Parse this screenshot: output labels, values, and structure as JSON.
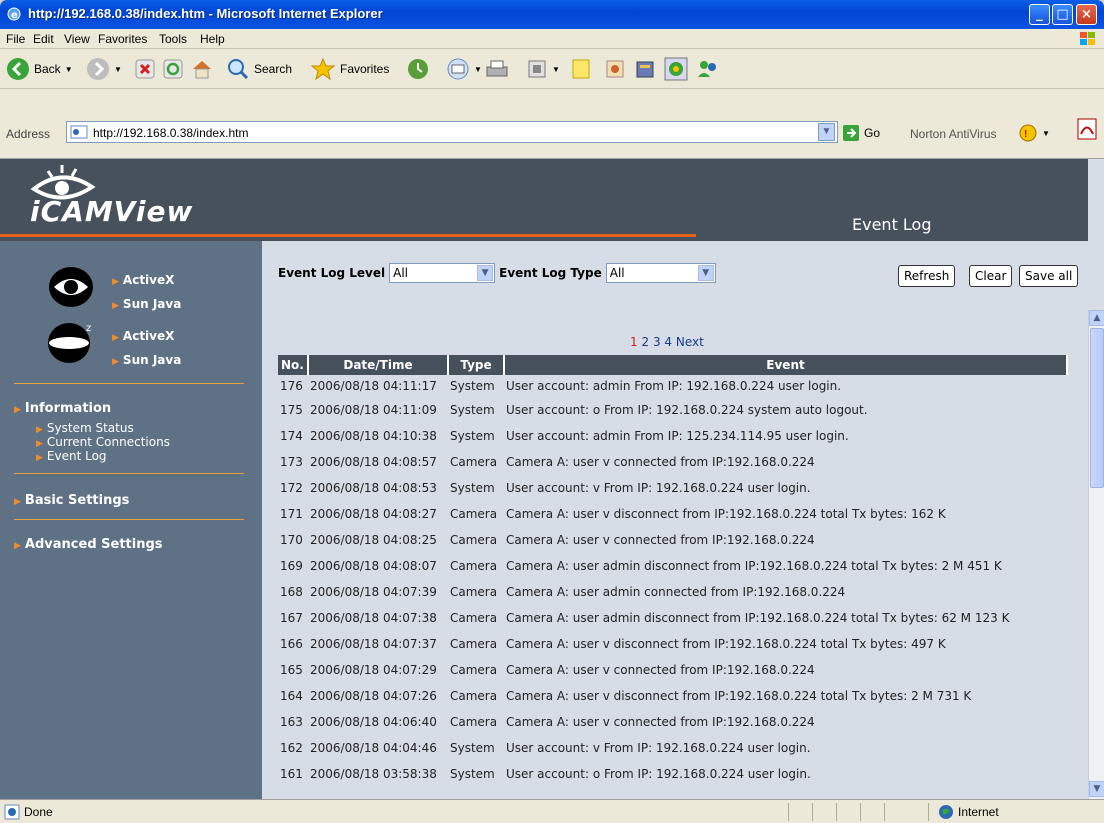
{
  "window": {
    "title": "http://192.168.0.38/index.htm - Microsoft Internet Explorer"
  },
  "menu": [
    "File",
    "Edit",
    "View",
    "Favorites",
    "Tools",
    "Help"
  ],
  "toolbar": {
    "back": "Back",
    "search": "Search",
    "favorites": "Favorites"
  },
  "address": {
    "label": "Address",
    "url": "http://192.168.0.38/index.htm",
    "go": "Go",
    "norton": "Norton AntiVirus"
  },
  "app": {
    "logo": "iCAMView",
    "heading": "Event Log"
  },
  "sidebar": {
    "cam1": {
      "activex": "ActiveX",
      "java": "Sun Java"
    },
    "cam2": {
      "activex": "ActiveX",
      "java": "Sun Java"
    },
    "information": "Information",
    "info_items": [
      "System Status",
      "Current Connections",
      "Event Log"
    ],
    "basic": "Basic Settings",
    "advanced": "Advanced Settings"
  },
  "filters": {
    "level_label": "Event Log Level",
    "level_value": "All",
    "type_label": "Event Log Type",
    "type_value": "All"
  },
  "buttons": {
    "refresh": "Refresh",
    "clear": "Clear",
    "save_all": "Save all"
  },
  "pagination": {
    "pages": [
      "1",
      "2",
      "3",
      "4"
    ],
    "current": "1",
    "next": "Next"
  },
  "table": {
    "headers": [
      "No.",
      "Date/Time",
      "Type",
      "Event"
    ],
    "rows": [
      [
        "176",
        "2006/08/18 04:11:17",
        "System",
        "User account: admin From IP: 192.168.0.224 user login."
      ],
      [
        "175",
        "2006/08/18 04:11:09",
        "System",
        "User account: o From IP: 192.168.0.224 system auto logout."
      ],
      [
        "174",
        "2006/08/18 04:10:38",
        "System",
        "User account: admin From IP: 125.234.114.95 user login."
      ],
      [
        "173",
        "2006/08/18 04:08:57",
        "Camera",
        "Camera A: user v connected from IP:192.168.0.224"
      ],
      [
        "172",
        "2006/08/18 04:08:53",
        "System",
        "User account: v From IP: 192.168.0.224 user login."
      ],
      [
        "171",
        "2006/08/18 04:08:27",
        "Camera",
        "Camera A: user v disconnect from IP:192.168.0.224 total Tx bytes: 162 K"
      ],
      [
        "170",
        "2006/08/18 04:08:25",
        "Camera",
        "Camera A: user v connected from IP:192.168.0.224"
      ],
      [
        "169",
        "2006/08/18 04:08:07",
        "Camera",
        "Camera A: user admin disconnect from IP:192.168.0.224 total Tx bytes: 2 M 451 K"
      ],
      [
        "168",
        "2006/08/18 04:07:39",
        "Camera",
        "Camera A: user admin connected from IP:192.168.0.224"
      ],
      [
        "167",
        "2006/08/18 04:07:38",
        "Camera",
        "Camera A: user admin disconnect from IP:192.168.0.224 total Tx bytes: 62 M 123 K"
      ],
      [
        "166",
        "2006/08/18 04:07:37",
        "Camera",
        "Camera A: user v disconnect from IP:192.168.0.224 total Tx bytes: 497 K"
      ],
      [
        "165",
        "2006/08/18 04:07:29",
        "Camera",
        "Camera A: user v connected from IP:192.168.0.224"
      ],
      [
        "164",
        "2006/08/18 04:07:26",
        "Camera",
        "Camera A: user v disconnect from IP:192.168.0.224 total Tx bytes: 2 M 731 K"
      ],
      [
        "163",
        "2006/08/18 04:06:40",
        "Camera",
        "Camera A: user v connected from IP:192.168.0.224"
      ],
      [
        "162",
        "2006/08/18 04:04:46",
        "System",
        "User account: v From IP: 192.168.0.224 user login."
      ],
      [
        "161",
        "2006/08/18 03:58:38",
        "System",
        "User account: o From IP: 192.168.0.224 user login."
      ]
    ]
  },
  "status": {
    "text": "Done",
    "zone": "Internet"
  },
  "colors": {
    "header": "#47515c",
    "sidebar": "#5f7285",
    "accent": "#e8631c",
    "content": "#d6dde6"
  }
}
